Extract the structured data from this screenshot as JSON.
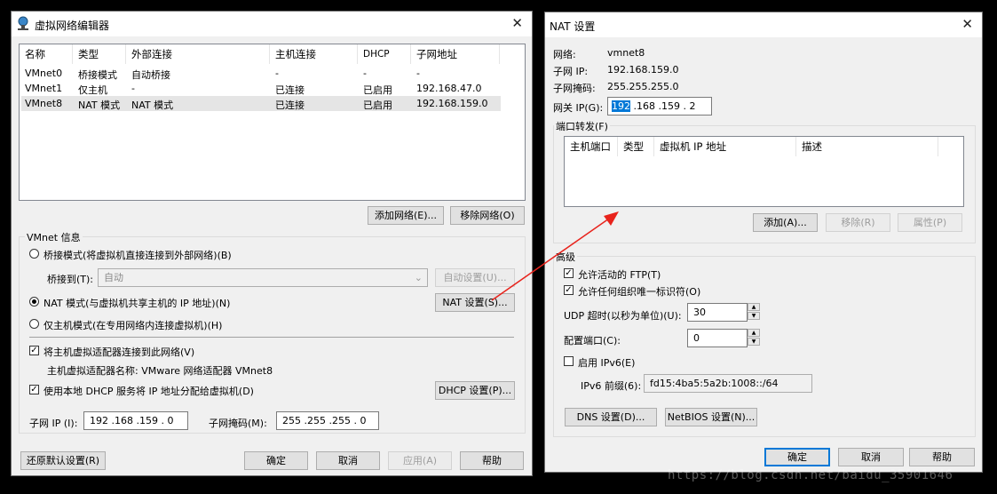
{
  "left": {
    "title": "虚拟网络编辑器",
    "columns": [
      "名称",
      "类型",
      "外部连接",
      "主机连接",
      "DHCP",
      "子网地址"
    ],
    "rows": [
      [
        "VMnet0",
        "桥接模式",
        "自动桥接",
        "-",
        "-",
        "-"
      ],
      [
        "VMnet1",
        "仅主机",
        "-",
        "已连接",
        "已启用",
        "192.168.47.0"
      ],
      [
        "VMnet8",
        "NAT 模式",
        "NAT 模式",
        "已连接",
        "已启用",
        "192.168.159.0"
      ]
    ],
    "add_network": "添加网络(E)...",
    "remove_network": "移除网络(O)",
    "vmnet_info": "VMnet 信息",
    "bridge_mode": "桥接模式(将虚拟机直接连接到外部网络)(B)",
    "bridge_to_label": "桥接到(T):",
    "bridge_to_value": "自动",
    "auto_settings": "自动设置(U)...",
    "nat_mode": "NAT 模式(与虚拟机共享主机的 IP 地址)(N)",
    "nat_settings": "NAT 设置(S)...",
    "host_only": "仅主机模式(在专用网络内连接虚拟机)(H)",
    "connect_adapter": "将主机虚拟适配器连接到此网络(V)",
    "adapter_name": "主机虚拟适配器名称: VMware 网络适配器 VMnet8",
    "use_dhcp": "使用本地 DHCP 服务将 IP 地址分配给虚拟机(D)",
    "dhcp_settings": "DHCP 设置(P)...",
    "subnet_ip_label": "子网 IP (I):",
    "subnet_ip_value": "192 .168 .159 . 0",
    "subnet_mask_label": "子网掩码(M):",
    "subnet_mask_value": "255 .255 .255 . 0",
    "restore_defaults": "还原默认设置(R)",
    "ok": "确定",
    "cancel": "取消",
    "apply": "应用(A)",
    "help": "帮助"
  },
  "right": {
    "title": "NAT 设置",
    "network_label": "网络:",
    "network_value": "vmnet8",
    "subnet_ip_label": "子网 IP:",
    "subnet_ip_value": "192.168.159.0",
    "subnet_mask_label": "子网掩码:",
    "subnet_mask_value": "255.255.255.0",
    "gateway_label": "网关 IP(G):",
    "gateway_sel": "192",
    "gateway_rest": " .168 .159 . 2",
    "port_forwarding": "端口转发(F)",
    "pf_columns": [
      "主机端口",
      "类型",
      "虚拟机 IP 地址",
      "描述"
    ],
    "add": "添加(A)...",
    "remove": "移除(R)",
    "properties": "属性(P)",
    "advanced": "高级",
    "allow_ftp": "允许活动的 FTP(T)",
    "allow_oui": "允许任何组织唯一标识符(O)",
    "udp_timeout_label": "UDP 超时(以秒为单位)(U):",
    "udp_timeout_value": "30",
    "config_port_label": "配置端口(C):",
    "config_port_value": "0",
    "enable_ipv6": "启用 IPv6(E)",
    "ipv6_prefix_label": "IPv6 前缀(6):",
    "ipv6_prefix_value": "fd15:4ba5:5a2b:1008::/64",
    "dns_settings": "DNS 设置(D)...",
    "netbios_settings": "NetBIOS 设置(N)...",
    "ok": "确定",
    "cancel": "取消",
    "help": "帮助"
  },
  "watermark": "https://blog.csdn.net/baidu_35901646",
  "colors": {
    "accent": "#0078d7",
    "arrow": "#e8231c",
    "window_bg": "#f0f0f0"
  }
}
